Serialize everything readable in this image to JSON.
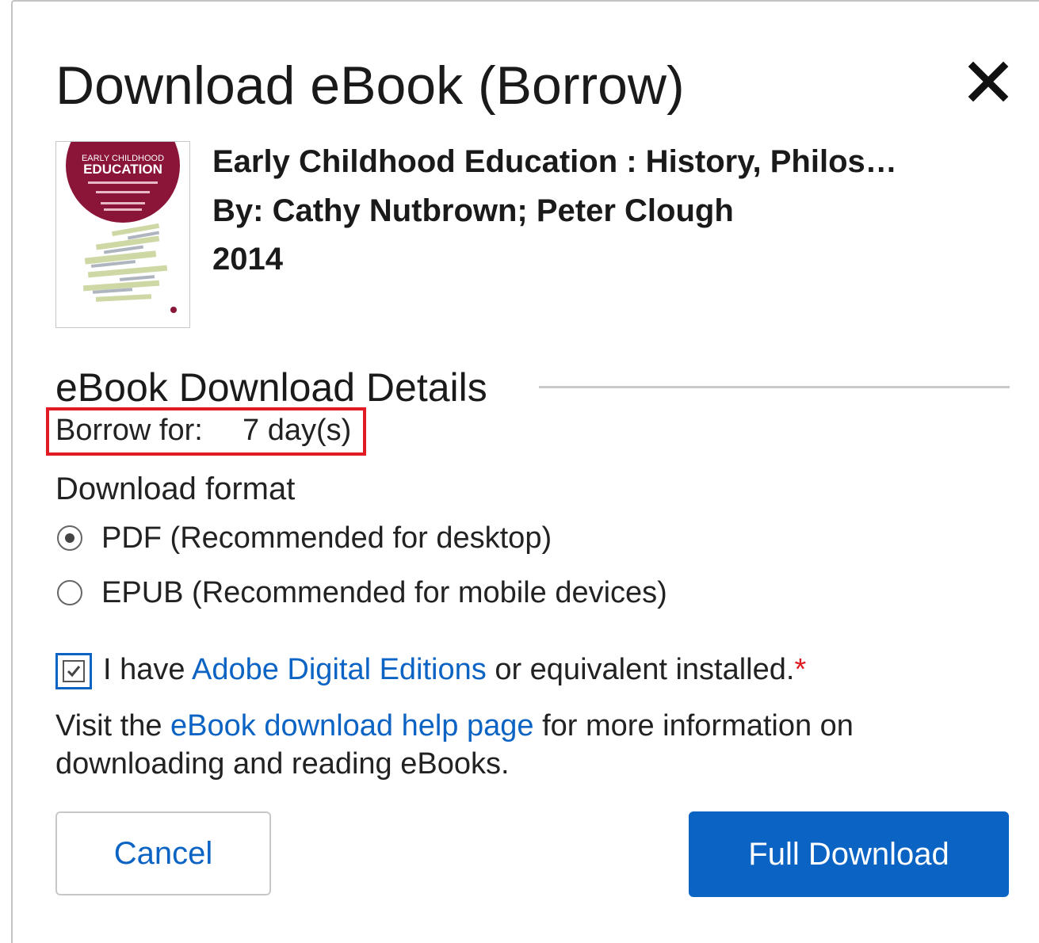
{
  "dialog": {
    "title": "Download eBook (Borrow)",
    "close_icon": "close-icon"
  },
  "book": {
    "cover_text": {
      "line1": "EARLY CHILDHOOD",
      "line2": "EDUCATION"
    },
    "title": "Early Childhood Education : History, Philos…",
    "author": "By: Cathy Nutbrown; Peter Clough",
    "year": "2014"
  },
  "details": {
    "heading": "eBook Download Details",
    "borrow_label": "Borrow for:",
    "borrow_value": "7 day(s)",
    "format_label": "Download format",
    "formats": [
      {
        "label": "PDF (Recommended for desktop)",
        "selected": true
      },
      {
        "label": "EPUB (Recommended for mobile devices)",
        "selected": false
      }
    ]
  },
  "agreement": {
    "prefix": "I have ",
    "link": "Adobe Digital Editions",
    "suffix": " or equivalent installed.",
    "required_mark": "*",
    "checked": true
  },
  "help": {
    "prefix": "Visit the ",
    "link": "eBook download help page",
    "suffix": " for more information on downloading and reading eBooks."
  },
  "buttons": {
    "cancel": "Cancel",
    "download": "Full Download"
  },
  "colors": {
    "accent": "#0b63c4",
    "highlight": "#e01b24",
    "cover_maroon": "#8b1538"
  }
}
